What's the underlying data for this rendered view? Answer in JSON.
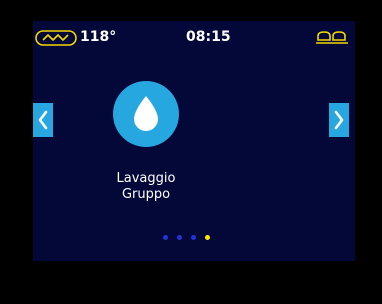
{
  "status": {
    "temperature": "118°",
    "time": "08:15",
    "boiler_icon": "boiler-heating-icon",
    "cups_icon": "cups-icon",
    "accent_color": "#f5d800"
  },
  "carousel": {
    "current_item": {
      "icon": "water-drop-icon",
      "label_line1": "Lavaggio",
      "label_line2": "Gruppo"
    },
    "prev_icon": "chevron-left-icon",
    "next_icon": "chevron-right-icon",
    "page_count": 4,
    "active_page": 4
  },
  "colors": {
    "screen_bg": "#030839",
    "button_blue": "#27a7e0",
    "dot_inactive": "#2233d6",
    "dot_active": "#ffe600"
  }
}
